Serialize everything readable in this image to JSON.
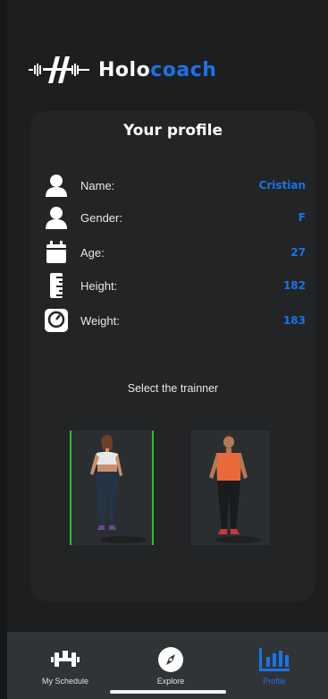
{
  "brand": {
    "name_part1": "Holo",
    "name_part2": "coach"
  },
  "profile": {
    "title": "Your profile",
    "fields": [
      {
        "icon": "person-icon",
        "label": "Name:",
        "value": "Cristian"
      },
      {
        "icon": "person-icon",
        "label": "Gender:",
        "value": "F"
      },
      {
        "icon": "calendar-icon",
        "label": "Age:",
        "value": "27"
      },
      {
        "icon": "ruler-icon",
        "label": "Height:",
        "value": "182"
      },
      {
        "icon": "scale-icon",
        "label": "Weight:",
        "value": "183"
      }
    ],
    "select_label": "Select the trainner",
    "trainers": [
      {
        "id": "female-trainer",
        "selected": true
      },
      {
        "id": "male-trainer",
        "selected": false
      }
    ]
  },
  "nav": {
    "items": [
      {
        "label": "My Schedule",
        "icon": "dumbbell-icon",
        "active": false
      },
      {
        "label": "Explore",
        "icon": "compass-icon",
        "active": false
      },
      {
        "label": "Profile",
        "icon": "bar-chart-icon",
        "active": true
      }
    ]
  },
  "colors": {
    "accent": "#1a73e8",
    "selection": "#22c32a",
    "background": "#1c1e20",
    "card": "#222426",
    "navbar": "#313436"
  }
}
